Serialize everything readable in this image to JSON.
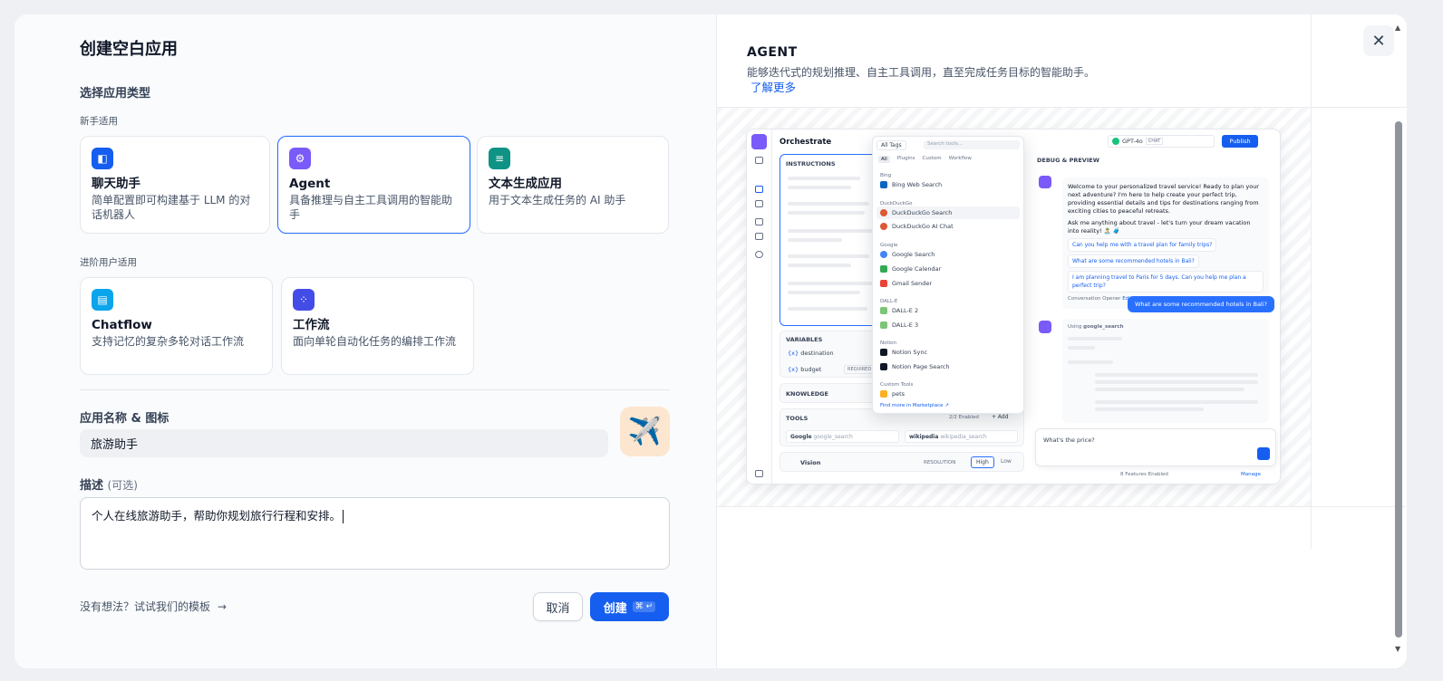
{
  "title": "创建空白应用",
  "select_type": "选择应用类型",
  "beginner_label": "新手适用",
  "advanced_label": "进阶用户适用",
  "cards": [
    {
      "name": "聊天助手",
      "desc": "简单配置即可构建基于 LLM 的对话机器人",
      "color": "#155eef",
      "icon": "chat-bot-icon"
    },
    {
      "name": "Agent",
      "desc": "具备推理与自主工具调用的智能助手",
      "color": "#7a5af8",
      "icon": "agent-icon"
    },
    {
      "name": "文本生成应用",
      "desc": "用于文本生成任务的 AI 助手",
      "color": "#0e9384",
      "icon": "text-gen-icon"
    },
    {
      "name": "Chatflow",
      "desc": "支持记忆的复杂多轮对话工作流",
      "color": "#0ba5ec",
      "icon": "chatflow-icon"
    },
    {
      "name": "工作流",
      "desc": "面向单轮自动化任务的编排工作流",
      "color": "#444ce7",
      "icon": "workflow-icon"
    }
  ],
  "name_icon_label": "应用名称 & 图标",
  "app_name_value": "旅游助手",
  "app_icon": "✈️",
  "desc_label": "描述",
  "desc_optional": "(可选)",
  "desc_value": "个人在线旅游助手，帮助你规划旅行行程和安排。",
  "template_link": "没有想法？试试我们的模板",
  "cancel": "取消",
  "create": "创建",
  "create_kbd": "⌘ ↵",
  "preview": {
    "heading": "AGENT",
    "description": "能够迭代式的规划推理、自主工具调用，直至完成任务目标的智能助手。",
    "learn_more": "了解更多",
    "mock": {
      "title": "Orchestrate",
      "instructions": "INSTRUCTIONS",
      "variables": "VARIABLES",
      "var1": "destination",
      "var2": "budget",
      "required": "REQUIRED",
      "knowledge": "KNOWLEDGE",
      "tools": "TOOLS",
      "tools_enabled": "2/2 Enabled",
      "add": "+ Add",
      "tool1": "Google",
      "tool1_sub": "google_search",
      "tool2": "wikipedia",
      "tool2_sub": "wikipedia_search",
      "vision": "Vision",
      "resolution": "RESOLUTION",
      "high": "High",
      "low": "Low",
      "all_tags": "All Tags",
      "search_tools": "Search tools...",
      "tabs": [
        "All",
        "Plugins",
        "Custom",
        "Workflow"
      ],
      "sections": [
        "Bing",
        "DuckDuckGo",
        "Google",
        "DALL-E",
        "Notion",
        "Custom Tools"
      ],
      "items": [
        "Bing Web Search",
        "DuckDuckGo Search",
        "DuckDuckGo AI Chat",
        "Google Search",
        "Google Calendar",
        "Gmail Sender",
        "DALL-E 2",
        "DALL-E 3",
        "Notion Sync",
        "Notion Page Search",
        "pets"
      ],
      "find_more": "Find more in",
      "marketplace": "Marketplace ↗",
      "model": "GPT-4o",
      "chat_tag": "CHAT",
      "publish": "Publish",
      "debug": "DEBUG & PREVIEW",
      "welcome": "Welcome to your personalized travel service! Ready to plan your next adventure? I'm here to help create your perfect trip, providing essential details and tips for destinations ranging from exciting cities to peaceful retreats.",
      "ask": "Ask me anything about travel - let's turn your dream vacation into reality! 🏝️ 🧳",
      "q1": "Can you help me with a travel plan for family trips?",
      "q2": "What are some recommended hotels in Bali?",
      "q3": "I am planning travel to Paris for 5 days. Can you help me plan a perfect trip?",
      "opener": "Conversation Opener",
      "edit": "Edit",
      "user_msg": "What are some recommended hotels in Bali?",
      "using": "Using",
      "using_tool": "google_search",
      "input": "What's the price?",
      "features": "8 Features Enabled",
      "manage": "Manage"
    }
  }
}
